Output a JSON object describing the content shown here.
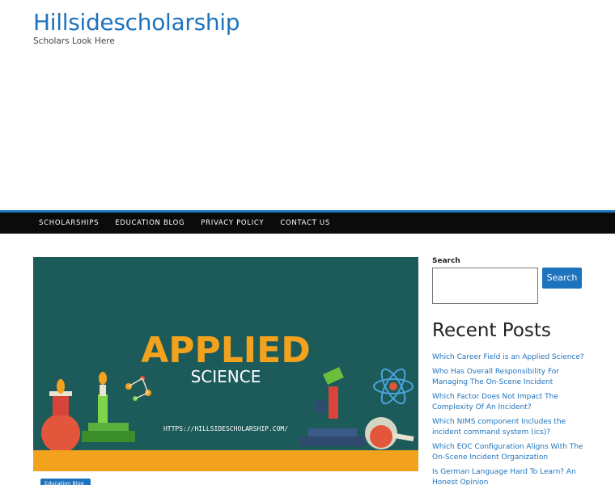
{
  "site": {
    "title": "Hillsidescholarship",
    "tagline": "Scholars Look Here"
  },
  "nav": {
    "items": [
      "SCHOLARSHIPS",
      "EDUCATION BLOG",
      "PRIVACY POLICY",
      "CONTACT US"
    ]
  },
  "hero": {
    "heading": "APPLIED",
    "subheading": "SCIENCE",
    "url": "HTTPS://HILLSIDESCHOLARSHIP.COM/"
  },
  "post": {
    "category_badge": "Education Blog"
  },
  "sidebar": {
    "search_label": "Search",
    "search_button": "Search",
    "recent_posts_title": "Recent Posts",
    "recent_posts": [
      "Which Career Field is an Applied Science?",
      "Who Has Overall Responsibility For Managing The On-Scene Incident",
      "Which Factor Does Not Impact The Complexity Of An Incident?",
      "Which NIMS component Includes the incident command system (ics)?",
      "Which EOC Configuration Aligns With The On-Scene Incident Organization",
      "Is German Language Hard To Learn? An Honest Opinion"
    ]
  },
  "colors": {
    "accent": "#1e73be",
    "nav_bg": "#0b0b0b",
    "hero_bg": "#1d5a5a",
    "hero_title": "#f3a21d"
  }
}
